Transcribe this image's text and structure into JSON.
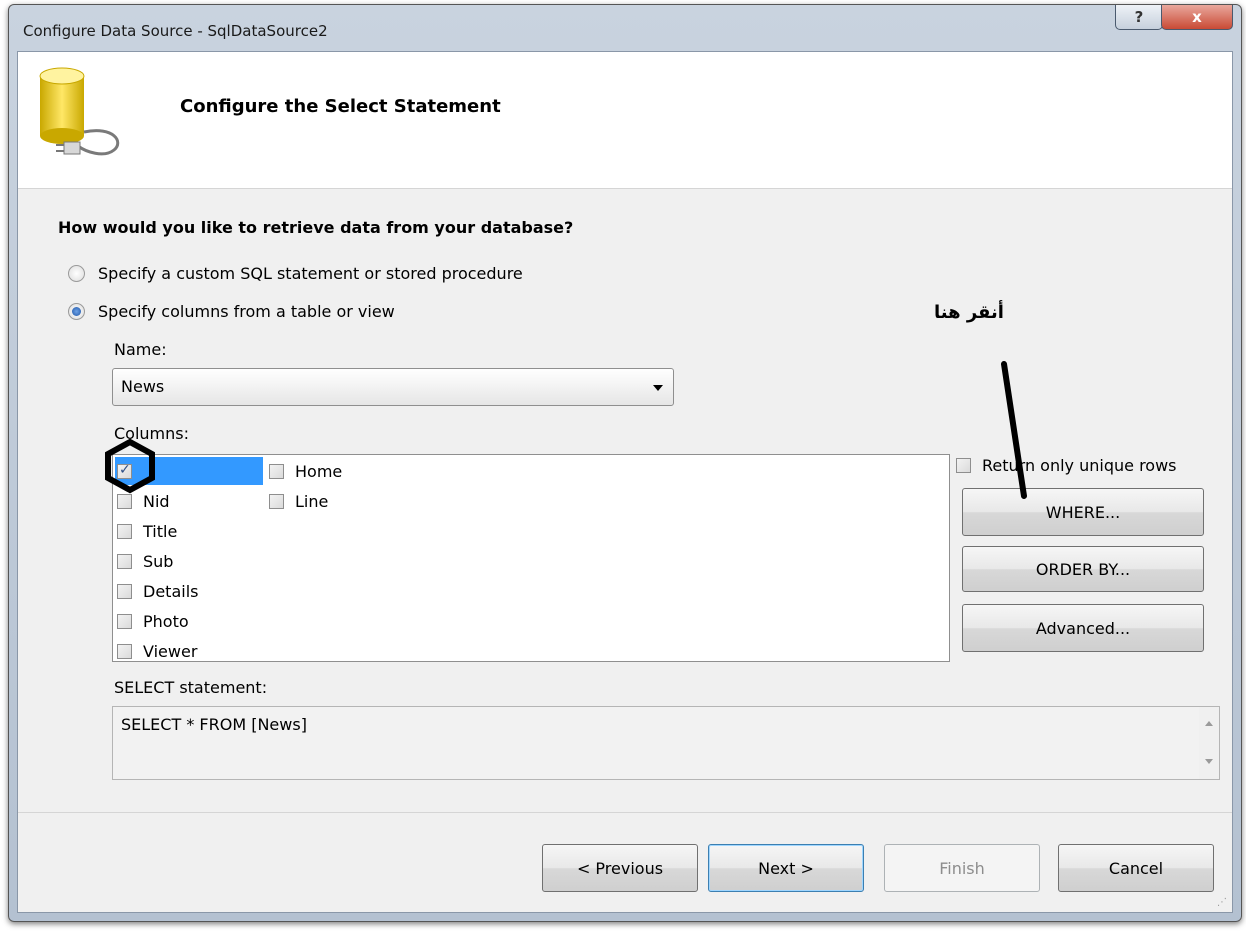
{
  "window": {
    "title": "Configure Data Source - SqlDataSource2",
    "help_label": "?",
    "close_label": "x"
  },
  "header": {
    "title": "Configure the Select Statement"
  },
  "question": "How would you like to retrieve data from your database?",
  "options": [
    {
      "label": "Specify a custom SQL statement or stored procedure",
      "selected": false
    },
    {
      "label": "Specify columns from a table or view",
      "selected": true
    }
  ],
  "name_field": {
    "label": "Name:",
    "value": "News"
  },
  "columns": {
    "label": "Columns:",
    "items": [
      {
        "label": "*",
        "checked": true
      },
      {
        "label": "Nid",
        "checked": false
      },
      {
        "label": "Title",
        "checked": false
      },
      {
        "label": "Sub",
        "checked": false
      },
      {
        "label": "Details",
        "checked": false
      },
      {
        "label": "Photo",
        "checked": false
      },
      {
        "label": "Viewer",
        "checked": false
      },
      {
        "label": "Home",
        "checked": false
      },
      {
        "label": "Line",
        "checked": false
      }
    ]
  },
  "unique_rows_label": "Return only unique rows",
  "side_buttons": {
    "where": "WHERE...",
    "order_by": "ORDER BY...",
    "advanced": "Advanced..."
  },
  "annotation": "أنقر هنا",
  "select_statement": {
    "label": "SELECT statement:",
    "value": "SELECT * FROM [News]"
  },
  "footer_buttons": {
    "previous": "< Previous",
    "next": "Next >",
    "finish": "Finish",
    "cancel": "Cancel"
  }
}
